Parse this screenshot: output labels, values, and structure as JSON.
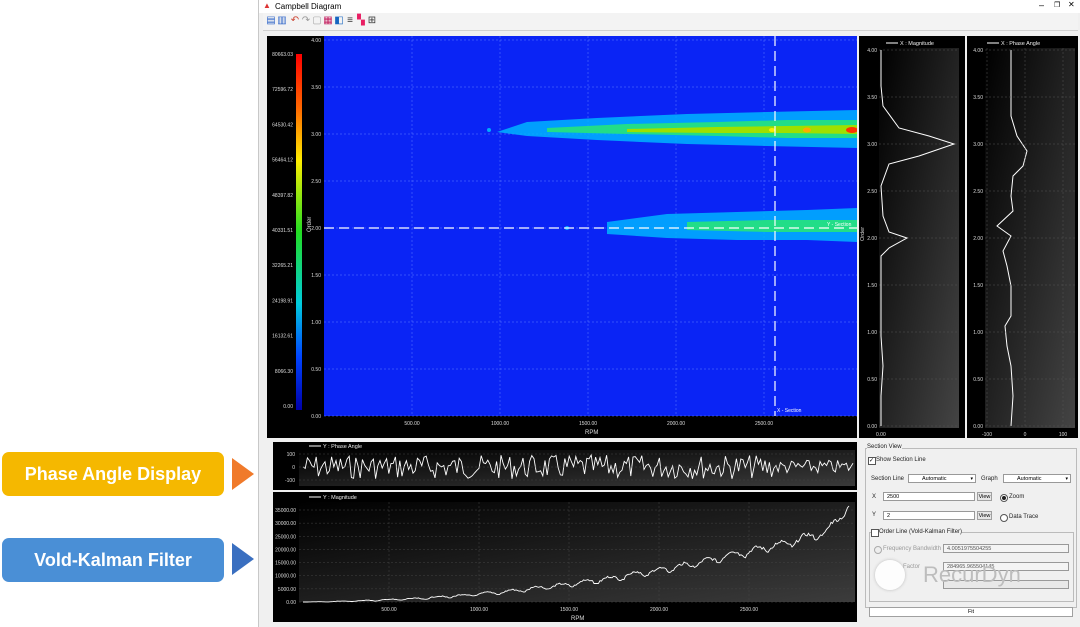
{
  "callouts": [
    {
      "label": "Phase Angle Display",
      "color": "#f5b800",
      "arrow": "#f07a2a"
    },
    {
      "label": "Vold-Kalman Filter",
      "color": "#4a8fd6",
      "arrow": "#3a6fc0"
    }
  ],
  "window": {
    "title": "Campbell Diagram"
  },
  "colorbar": {
    "ticks": [
      "80663.03",
      "72596.72",
      "64530.42",
      "56464.12",
      "48397.82",
      "40331.51",
      "32265.21",
      "24198.91",
      "16132.61",
      "8066.30",
      "0.00"
    ]
  },
  "campbell": {
    "ylabel": "Order",
    "xlabel": "RPM",
    "yticks": [
      "4.00",
      "3.50",
      "3.00",
      "2.50",
      "2.00",
      "1.50",
      "1.00",
      "0.50",
      "0.00"
    ],
    "xticks": [
      "500.00",
      "1000.00",
      "1500.00",
      "2000.00",
      "2500.00"
    ],
    "y_section_label": "Y - Section",
    "x_section_label": "X - Section"
  },
  "mag_panel": {
    "legend": "X : Magnitude",
    "ylabel": "Order",
    "yticks": [
      "4.00",
      "3.50",
      "3.00",
      "2.50",
      "2.00",
      "1.50",
      "1.00",
      "0.50",
      "0.00"
    ],
    "xtick": "0.00"
  },
  "phase_panel": {
    "legend": "X : Phase Angle",
    "yticks": [
      "4.00",
      "3.50",
      "3.00",
      "2.50",
      "2.00",
      "1.50",
      "1.00",
      "0.50",
      "0.00"
    ],
    "xticks": [
      "-100",
      "0",
      "100"
    ]
  },
  "phase_plot": {
    "legend": "Y : Phase Angle",
    "yticks": [
      "100",
      "0",
      "-100"
    ]
  },
  "magnitude_plot": {
    "legend": "Y : Magnitude",
    "yticks": [
      "35000.00",
      "30000.00",
      "25000.00",
      "20000.00",
      "15000.00",
      "10000.00",
      "5000.00",
      "0.00"
    ],
    "xticks": [
      "500.00",
      "1000.00",
      "1500.00",
      "2000.00",
      "2500.00"
    ],
    "xlabel": "RPM"
  },
  "section_view": {
    "group_title": "Section View",
    "show_section_line": "Show Section Line",
    "section_line_label": "Section Line",
    "section_line_value": "Automatic",
    "graph_label": "Graph",
    "graph_value": "Automatic",
    "x_label": "X",
    "x_value": "2500",
    "y_label": "Y",
    "y_value": "2",
    "view_label": "View",
    "zoom_label": "Zoom",
    "data_trace_label": "Data Trace",
    "order_line_label": "Order Line (Vold-Kalman Filter)",
    "freq_bandwidth_label": "Frequency Bandwidth",
    "freq_bandwidth_value": "4.0051975504255",
    "factor_label": "Factor",
    "factor_value": "284965.965504145",
    "fit_label": "Fit"
  },
  "watermark": "RecurDyn"
}
